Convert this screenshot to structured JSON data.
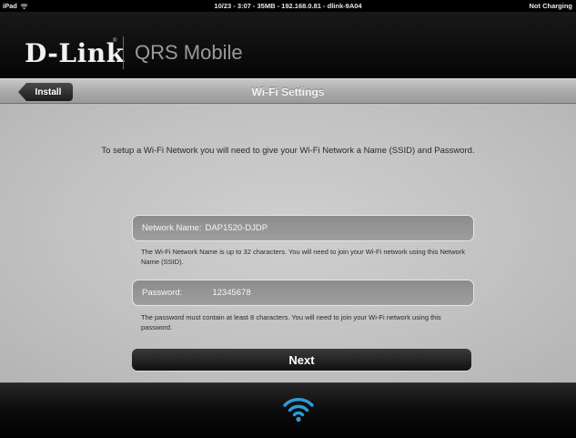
{
  "status_bar": {
    "device": "iPad",
    "center": "10/23 - 3:07 - 35MB - 192.168.0.81 - dlink-9A04",
    "battery": "Not Charging"
  },
  "brand": {
    "logo": "D-Link",
    "registered": "®",
    "app_name": "QRS Mobile"
  },
  "nav": {
    "back_label": "Install",
    "title": "Wi-Fi Settings"
  },
  "main": {
    "intro": "To setup a Wi-Fi Network you will need to give your Wi-Fi Network a Name (SSID) and Password.",
    "ssid": {
      "label": "Network Name:",
      "value": "DAP1520-DJDP",
      "help": "The Wi-Fi Network Name is up to 32 characters. You will need to join your Wi-Fi network using this Network Name (SSID)."
    },
    "password": {
      "label": "Password:",
      "value": "12345678",
      "help": "The password must contain at least 8 characters.  You will need to join your Wi-Fi network using this password."
    },
    "next_label": "Next"
  },
  "footer": {
    "icon": "wifi-icon",
    "accent_color": "#2f9bd6"
  }
}
